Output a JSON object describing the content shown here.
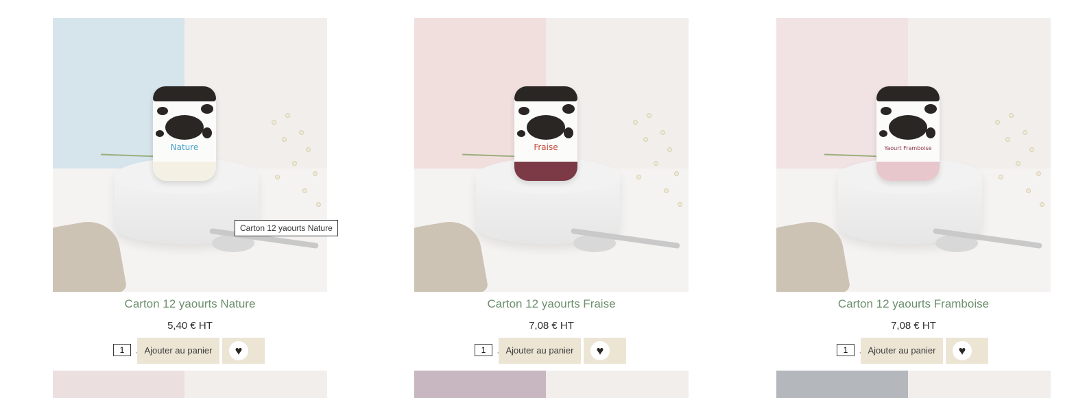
{
  "products": [
    {
      "title": "Carton 12 yaourts Nature",
      "price": "5,40 € HT",
      "qty": "1",
      "add_label": "Ajouter au panier",
      "flavor_label": "Nature",
      "bg_color": "#d6e4ec",
      "flavor_color": "#4aa3c8",
      "fill_color": "#f4f0e3"
    },
    {
      "title": "Carton 12 yaourts Fraise",
      "price": "7,08 € HT",
      "qty": "1",
      "add_label": "Ajouter au panier",
      "flavor_label": "Fraise",
      "bg_color": "#f1dfde",
      "flavor_color": "#c24a3a",
      "fill_color": "#7b3a46"
    },
    {
      "title": "Carton 12 yaourts Framboise",
      "price": "7,08 € HT",
      "qty": "1",
      "add_label": "Ajouter au panier",
      "flavor_label": "Yaourt Framboise",
      "bg_color": "#f1e2e3",
      "flavor_color": "#8a3344",
      "fill_color": "#e8c7cc"
    }
  ],
  "tooltip": "Carton 12 yaourts Nature",
  "plus_sign": "+",
  "wishlist_icon": "heart-icon",
  "next_row_colors": [
    "#ecdfdf",
    "#c8b6c0",
    "#b4b8bc"
  ]
}
